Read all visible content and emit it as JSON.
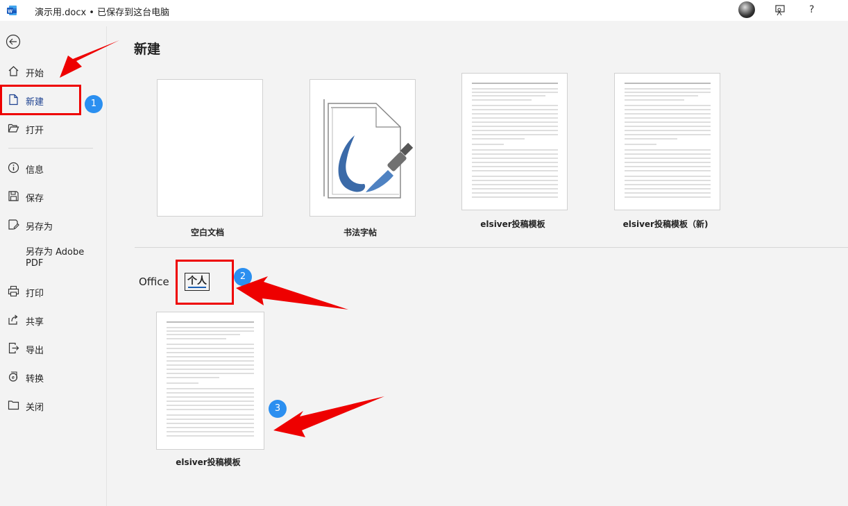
{
  "titlebar": {
    "doc_title": "演示用.docx • 已保存到这台电脑",
    "help": "?",
    "icons": [
      "word-logo-icon",
      "avatar",
      "feedback-icon",
      "help-icon"
    ]
  },
  "sidebar": {
    "items": [
      {
        "label": "开始",
        "icon": "home-icon"
      },
      {
        "label": "新建",
        "icon": "new-document-icon",
        "active": true
      },
      {
        "label": "打开",
        "icon": "open-folder-icon"
      },
      {
        "label": "信息",
        "icon": "info-icon"
      },
      {
        "label": "保存",
        "icon": "save-icon"
      },
      {
        "label": "另存为",
        "icon": "save-as-icon"
      },
      {
        "label": "另存为 Adobe PDF",
        "icon": ""
      },
      {
        "label": "打印",
        "icon": "print-icon"
      },
      {
        "label": "共享",
        "icon": "share-icon"
      },
      {
        "label": "导出",
        "icon": "export-icon"
      },
      {
        "label": "转换",
        "icon": "convert-icon"
      },
      {
        "label": "关闭",
        "icon": "close-folder-icon"
      }
    ]
  },
  "main": {
    "title": "新建",
    "templates": [
      {
        "label": "空白文档"
      },
      {
        "label": "书法字帖"
      },
      {
        "label": "elsiver投稿模板"
      },
      {
        "label": "elsiver投稿模板（新)"
      }
    ],
    "tabs": {
      "office": "Office",
      "personal": "个人"
    },
    "personal_templates": [
      {
        "label": "elsiver投稿模板"
      }
    ]
  },
  "annotations": {
    "badges": [
      "1",
      "2",
      "3"
    ],
    "color": "#e00000",
    "badge_color": "#2b8ff0"
  }
}
